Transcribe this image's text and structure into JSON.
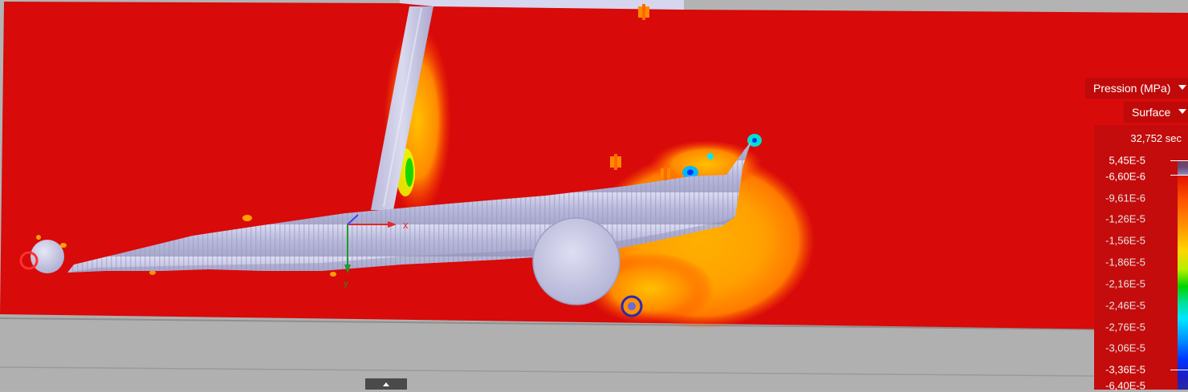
{
  "viewer": {
    "quantity_dropdown": {
      "label": "Pression (MPa)"
    },
    "mode_dropdown": {
      "label": "Surface"
    },
    "triad": {
      "x_label": "x",
      "y_label": "y"
    }
  },
  "legend": {
    "time": "32,752 sec",
    "labels": [
      "5,45E-5",
      "-6,60E-6",
      "-9,61E-6",
      "-1,26E-5",
      "-1,56E-5",
      "-1,86E-5",
      "-2,16E-5",
      "-2,46E-5",
      "-2,76E-5",
      "-3,06E-5",
      "-3,36E-5",
      "-6,40E-5"
    ]
  },
  "colors": {
    "field_background": "#d80a0a",
    "legend_background": "#c40c0c",
    "part": "#c9c9e8",
    "floor": "#b3b3b3"
  }
}
